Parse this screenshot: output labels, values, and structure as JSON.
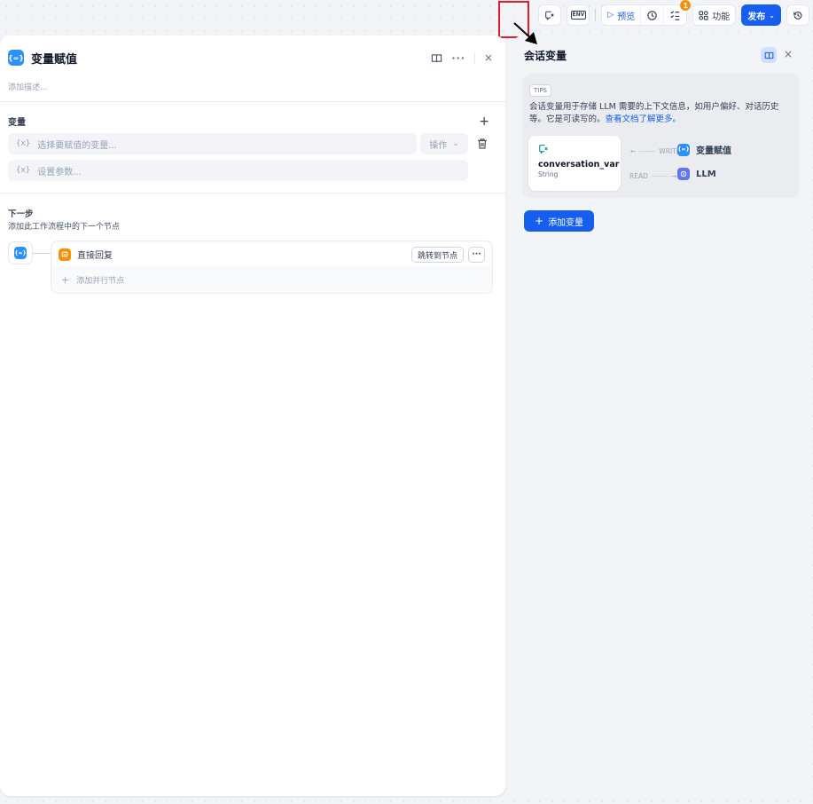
{
  "toolbar": {
    "env_label": "ENV",
    "preview_label": "预览",
    "checklist_badge": "1",
    "features_label": "功能",
    "publish_label": "发布"
  },
  "node_panel": {
    "icon_text": "{=}",
    "title": "变量赋值",
    "description_placeholder": "添加描述...",
    "variables_section_label": "变量",
    "variable_selector_placeholder": "选择要赋值的变量...",
    "operation_placeholder": "操作",
    "param_placeholder": "设置参数...",
    "brace_glyph": "{x}",
    "next_step_label": "下一步",
    "next_step_description": "添加此工作流程中的下一个节点",
    "next_node_name": "直接回复",
    "jump_to_node_label": "跳转到节点",
    "add_parallel_label": "添加并行节点"
  },
  "conversation_panel": {
    "title": "会话变量",
    "tips_tag": "TIPS",
    "tips_text": "会话变量用于存储 LLM 需要的上下文信息，如用户偏好、对话历史等。它是可读写的。",
    "tips_link": "查看文档了解更多。",
    "example_var_name": "conversation_var",
    "example_var_type": "String",
    "write_label": "WRITE",
    "read_label": "READ",
    "write_target_icon": "{=}",
    "write_target": "变量赋值",
    "read_target": "LLM",
    "add_variable_label": "添加变量"
  }
}
